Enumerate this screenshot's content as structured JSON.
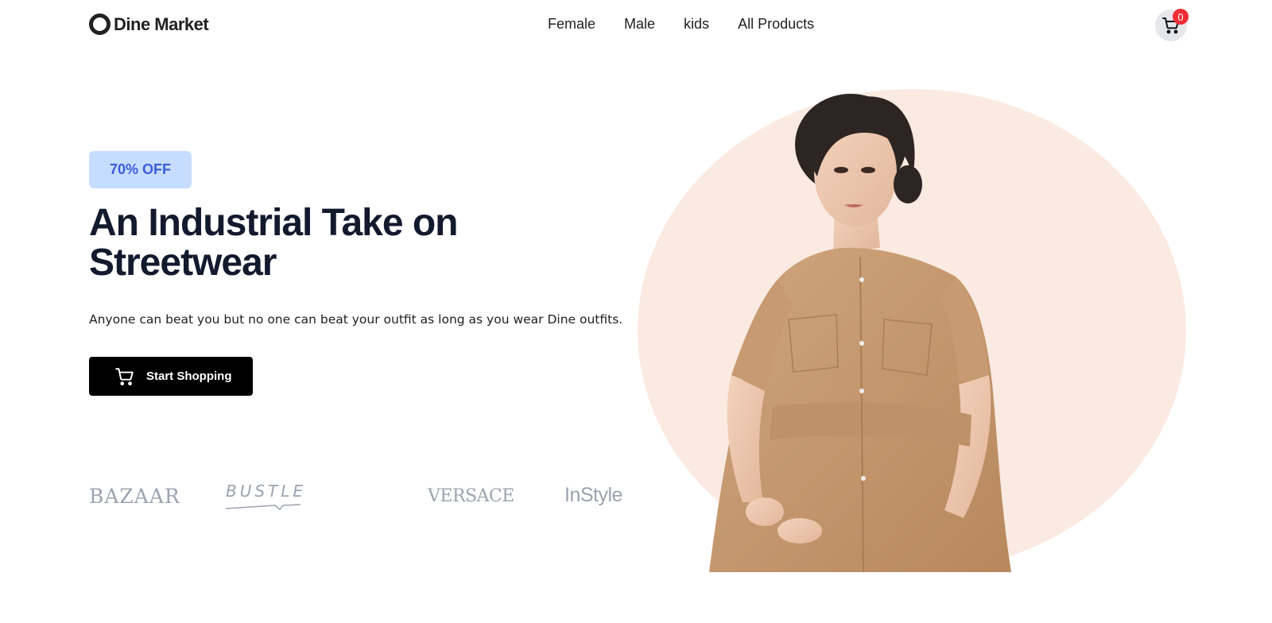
{
  "header": {
    "logo_text": "Dine Market",
    "nav": [
      "Female",
      "Male",
      "kids",
      "All Products"
    ],
    "cart_count": "0"
  },
  "hero": {
    "badge": "70% OFF",
    "title": "An Industrial Take on Streetwear",
    "subtitle": "Anyone can beat you but no one can beat your outfit as long as you wear Dine outfits.",
    "cta_label": "Start Shopping"
  },
  "brands": [
    "BAZAAR",
    "BUSTLE",
    "VERSACE",
    "InStyle"
  ],
  "colors": {
    "accent_badge_bg": "#c7ddff",
    "accent_badge_text": "#3b5bdb",
    "hero_circle": "#fbeae1",
    "cart_badge": "#f02d34",
    "cta_bg": "#000000"
  }
}
